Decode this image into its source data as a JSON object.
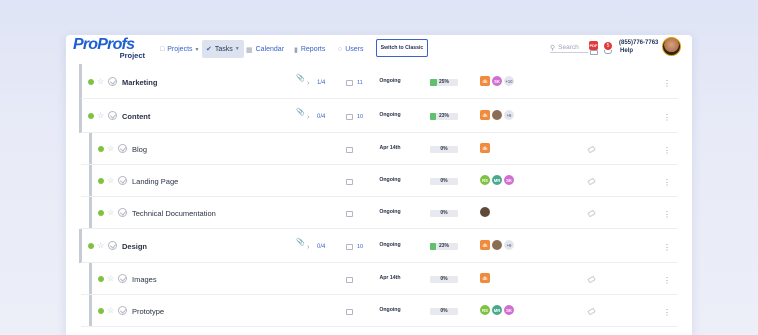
{
  "logo": {
    "text_a": "Pro",
    "text_b": "Profs",
    "product": "Project"
  },
  "nav": [
    {
      "label": "Projects",
      "icon": "folder-icon",
      "dropdown": true,
      "active": false
    },
    {
      "label": "Tasks",
      "icon": "check-circle-icon",
      "dropdown": true,
      "active": true
    },
    {
      "label": "Calendar",
      "icon": "calendar-icon",
      "dropdown": false,
      "active": false
    },
    {
      "label": "Reports",
      "icon": "bar-chart-icon",
      "dropdown": false,
      "active": false
    },
    {
      "label": "Users",
      "icon": "user-icon",
      "dropdown": false,
      "active": false
    }
  ],
  "switch_button": "Switch to Classic",
  "search": {
    "placeholder": "Search",
    "icon": "search-icon"
  },
  "notifications": {
    "count": "5",
    "icon": "bell-icon"
  },
  "pdf_icon": "PDF",
  "help": {
    "phone": "(855)776-7763",
    "label": "Help"
  },
  "colors": {
    "accent": "#3b62c9",
    "green": "#7ec241",
    "progress": "#61c06e",
    "orange": "#f08a3c",
    "red": "#e03a3a"
  },
  "tasks": [
    {
      "title": "Marketing",
      "level": 0,
      "attachment": true,
      "subtasks": "1/4",
      "comments": "11",
      "status": "Ongoing",
      "progress": 25,
      "progress_label": "25%",
      "assignees": [
        {
          "initials": "dk",
          "color": "#f08a3c",
          "square": true
        },
        {
          "initials": "SK",
          "color": "#d06fd0",
          "square": false
        }
      ],
      "more": "+10",
      "tag": false
    },
    {
      "title": "Content",
      "level": 0,
      "attachment": true,
      "subtasks": "0/4",
      "comments": "10",
      "status": "Ongoing",
      "progress": 23,
      "progress_label": "23%",
      "assignees": [
        {
          "initials": "dk",
          "color": "#f08a3c",
          "square": true
        },
        {
          "initials": "",
          "color": "#8b6d55",
          "square": false
        }
      ],
      "more": "+5",
      "tag": false
    },
    {
      "title": "Blog",
      "level": 1,
      "attachment": false,
      "subtasks": "",
      "comments": "",
      "status": "Apr 14th",
      "progress": 0,
      "progress_label": "0%",
      "assignees": [
        {
          "initials": "dk",
          "color": "#f08a3c",
          "square": true
        }
      ],
      "more": "",
      "tag": true
    },
    {
      "title": "Landing Page",
      "level": 1,
      "attachment": false,
      "subtasks": "",
      "comments": "",
      "status": "Ongoing",
      "progress": 0,
      "progress_label": "0%",
      "assignees": [
        {
          "initials": "RS",
          "color": "#7ec241",
          "square": false
        },
        {
          "initials": "MR",
          "color": "#4aa88f",
          "square": false
        },
        {
          "initials": "SK",
          "color": "#d06fd0",
          "square": false
        }
      ],
      "more": "",
      "tag": true
    },
    {
      "title": "Technical Documentation",
      "level": 1,
      "attachment": false,
      "subtasks": "",
      "comments": "",
      "status": "Ongoing",
      "progress": 0,
      "progress_label": "0%",
      "assignees": [
        {
          "initials": "",
          "color": "#5f4a3a",
          "square": false
        }
      ],
      "more": "",
      "tag": true
    },
    {
      "title": "Design",
      "level": 0,
      "attachment": true,
      "subtasks": "0/4",
      "comments": "10",
      "status": "Ongoing",
      "progress": 23,
      "progress_label": "23%",
      "assignees": [
        {
          "initials": "dk",
          "color": "#f08a3c",
          "square": true
        },
        {
          "initials": "",
          "color": "#8b6d55",
          "square": false
        }
      ],
      "more": "+9",
      "tag": false
    },
    {
      "title": "Images",
      "level": 1,
      "attachment": false,
      "subtasks": "",
      "comments": "",
      "status": "Apr 14th",
      "progress": 0,
      "progress_label": "0%",
      "assignees": [
        {
          "initials": "dk",
          "color": "#f08a3c",
          "square": true
        }
      ],
      "more": "",
      "tag": true
    },
    {
      "title": "Prototype",
      "level": 1,
      "attachment": false,
      "subtasks": "",
      "comments": "",
      "status": "Ongoing",
      "progress": 0,
      "progress_label": "0%",
      "assignees": [
        {
          "initials": "RS",
          "color": "#7ec241",
          "square": false
        },
        {
          "initials": "MR",
          "color": "#4aa88f",
          "square": false
        },
        {
          "initials": "SK",
          "color": "#d06fd0",
          "square": false
        }
      ],
      "more": "",
      "tag": true
    }
  ]
}
